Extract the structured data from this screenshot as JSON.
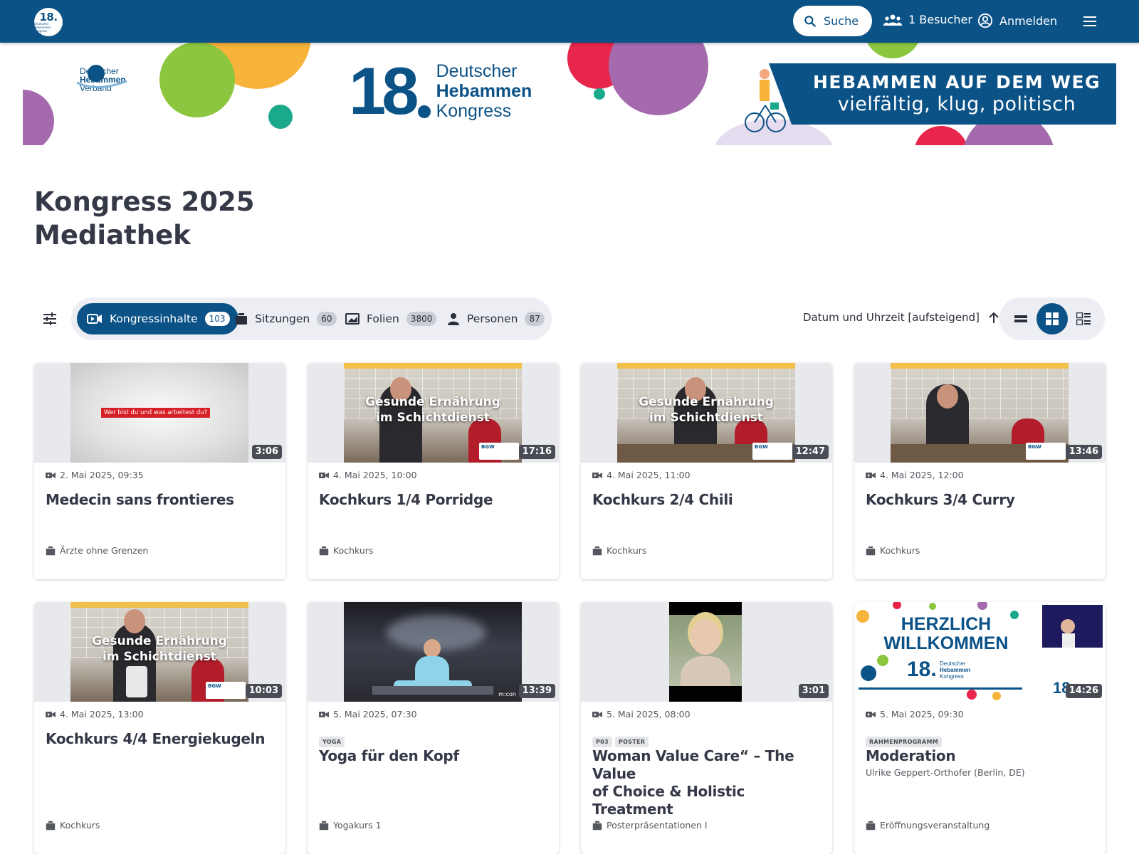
{
  "header": {
    "logo_number": "18.",
    "logo_small": "Deutscher Hebammen Kongress",
    "search_label": "Suche",
    "visitors_label": "1 Besucher",
    "login_label": "Anmelden"
  },
  "banner": {
    "dhv_line1": "Deutscher",
    "dhv_line2": "Hebammen",
    "dhv_line3": "Verband",
    "kongress_number": "18",
    "kongress_line1": "Deutscher",
    "kongress_line2": "Hebammen",
    "kongress_line3": "Kongress",
    "motto_line1": "HEBAMMEN AUF DEM WEG",
    "motto_line2": "vielfältig, klug, politisch"
  },
  "page": {
    "title_line1": "Kongress 2025",
    "title_line2": "Mediathek"
  },
  "tabs": [
    {
      "label": "Kongressinhalte",
      "count": "103",
      "active": true
    },
    {
      "label": "Sitzungen",
      "count": "60",
      "active": false
    },
    {
      "label": "Folien",
      "count": "3800",
      "active": false
    },
    {
      "label": "Personen",
      "count": "87",
      "active": false
    }
  ],
  "sort": {
    "label": "Datum und Uhrzeit [aufsteigend]"
  },
  "colors": {
    "brand": "#0b5287",
    "tab_bg": "#eceef3",
    "apron": "#b31d2a"
  },
  "cards": [
    {
      "duration": "3:06",
      "date": "2. Mai 2025, 09:35",
      "title": "Medecin sans frontieres",
      "session": "Ärzte ohne Grenzen",
      "thumb_text": "Wer bist du und was arbeitest du?"
    },
    {
      "duration": "17:16",
      "date": "4. Mai 2025, 10:00",
      "title": "Kochkurs 1/4 Porridge",
      "session": "Kochkurs",
      "thumb_line1": "Gesunde Ernährung",
      "thumb_line2": "im Schichtdienst"
    },
    {
      "duration": "12:47",
      "date": "4. Mai 2025, 11:00",
      "title": "Kochkurs 2/4 Chili",
      "session": "Kochkurs",
      "thumb_line1": "Gesunde Ernährung",
      "thumb_line2": "im Schichtdienst"
    },
    {
      "duration": "13:46",
      "date": "4. Mai 2025, 12:00",
      "title": "Kochkurs 3/4 Curry",
      "session": "Kochkurs"
    },
    {
      "duration": "10:03",
      "date": "4. Mai 2025, 13:00",
      "title": "Kochkurs 4/4 Energiekugeln",
      "session": "Kochkurs",
      "thumb_line1": "Gesunde Ernährung",
      "thumb_line2": "im Schichtdienst"
    },
    {
      "duration": "13:39",
      "date": "5. Mai 2025, 07:30",
      "tags": [
        "YOGA"
      ],
      "title": "Yoga für den Kopf",
      "session": "Yogakurs 1",
      "thumb_text": "m:con"
    },
    {
      "duration": "3:01",
      "date": "5. Mai 2025, 08:00",
      "tags": [
        "P03",
        "POSTER"
      ],
      "title_line1": "Woman Value Care“ – The Value",
      "title_line2": "of Choice & Holistic Treatment",
      "session": "Posterpräsentationen I"
    },
    {
      "duration": "14:26",
      "date": "5. Mai 2025, 09:30",
      "tags": [
        "RAHMENPROGRAMM"
      ],
      "title": "Moderation",
      "speaker": "Ulrike Geppert-Orthofer (Berlin, DE)",
      "session": "Eröffnungsveranstaltung",
      "thumb_line1": "HERZLICH",
      "thumb_line2": "WILLKOMMEN",
      "thumb_number": "18.",
      "thumb_small1": "Deutscher",
      "thumb_small2": "Hebammen",
      "thumb_small3": "Kongress",
      "thumb_side_number": "18"
    }
  ]
}
